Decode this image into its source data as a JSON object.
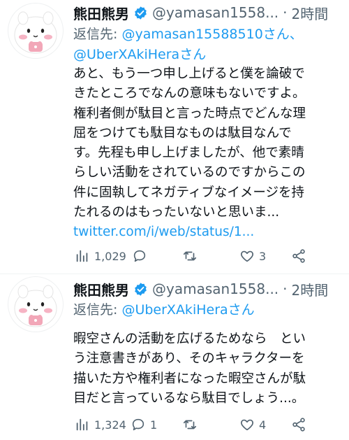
{
  "tweets": [
    {
      "author": {
        "name": "熊田熊男",
        "handle": "@yamasan1558...",
        "separator": "·",
        "time": "2時間"
      },
      "reply": {
        "prefix": "返信先: ",
        "mentions_line1": "@yamasan15588510さん、",
        "mentions_line2": "@UberXAkiHeraさん"
      },
      "text_lines": [
        "あと、もう一つ申し上げると僕を論破で",
        "きたところでなんの意味もないですよ。",
        "権利者側が駄目と言った時点でどんな理",
        "屈をつけても駄目なものは駄目なんで",
        "す。先程も申し上げましたが、他で素晴",
        "らしい活動をされているのですからこの",
        "件に固執してネガティブなイメージを持",
        "たれるのはもったいないと思いま..."
      ],
      "link": "twitter.com/i/web/status/1...",
      "stats": {
        "views": "1,029",
        "replies": "",
        "retweets": "",
        "likes": "3"
      }
    },
    {
      "author": {
        "name": "熊田熊男",
        "handle": "@yamasan1558...",
        "separator": "·",
        "time": "2時間"
      },
      "reply": {
        "prefix": "返信先: ",
        "mentions_line1": "@UberXAkiHeraさん"
      },
      "text_lines": [
        "暇空さんの活動を広げるためなら　とい",
        "う注意書きがあり、そのキャラクターを",
        "描いた方や権利者になった暇空さんが駄",
        "目だと言っているなら駄目でしょう...。"
      ],
      "stats": {
        "views": "1,324",
        "replies": "1",
        "retweets": "",
        "likes": "4"
      }
    }
  ],
  "icons": {
    "verified": "verified-badge-icon",
    "views": "bar-chart-icon",
    "reply": "speech-bubble-icon",
    "retweet": "retweet-icon",
    "like": "heart-icon",
    "share": "share-icon",
    "more": "more-dots-icon"
  },
  "colors": {
    "accent": "#1d9bf0",
    "secondary_text": "#536471",
    "primary_text": "#0f1419"
  }
}
